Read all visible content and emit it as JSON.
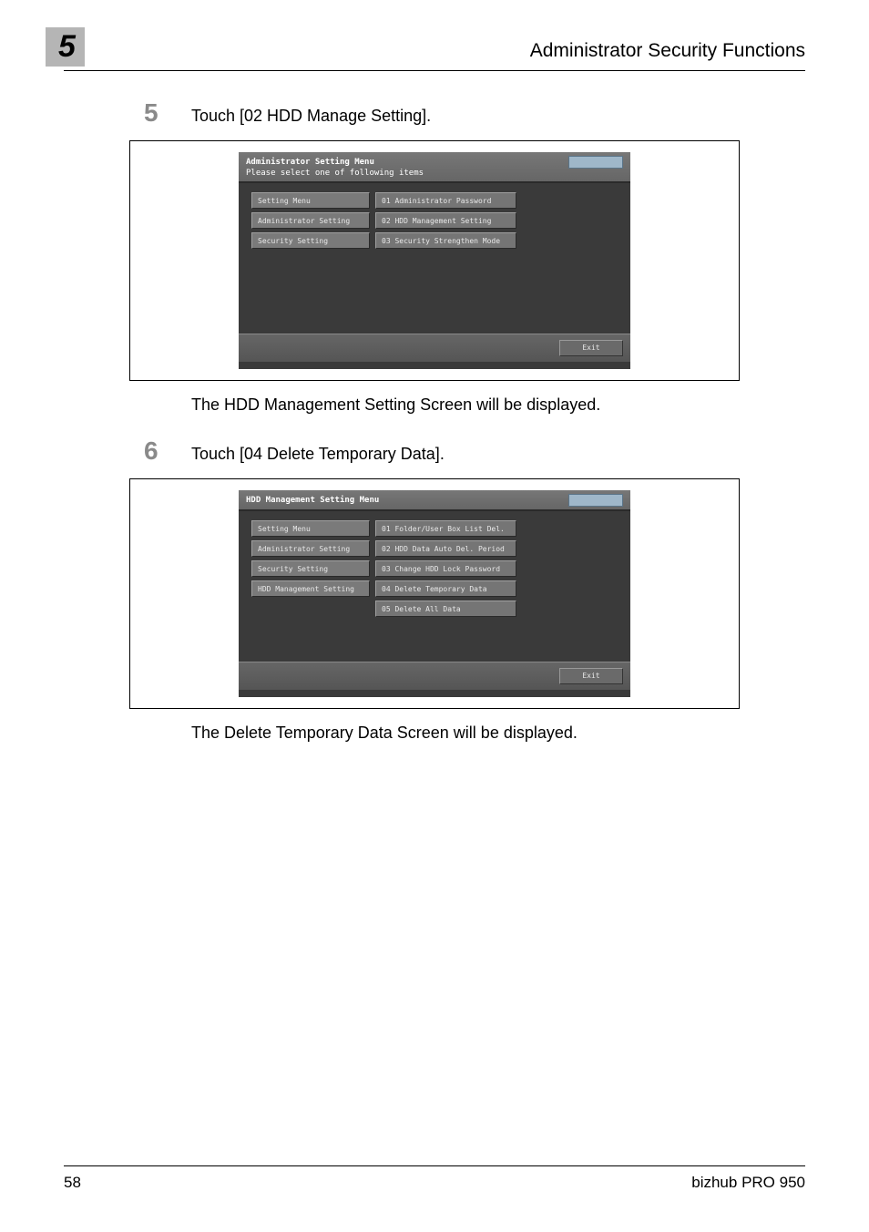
{
  "page": {
    "chapter_num": "5",
    "header_title": "Administrator Security Functions",
    "footer_page": "58",
    "footer_model": "bizhub PRO 950"
  },
  "step5": {
    "num": "5",
    "text": "Touch [02 HDD Manage Setting].",
    "after_text": "The HDD Management Setting Screen will be displayed."
  },
  "step6": {
    "num": "6",
    "text": "Touch [04 Delete Temporary Data].",
    "after_text": "The Delete Temporary Data Screen will be displayed."
  },
  "screen1": {
    "title": "Administrator Setting Menu",
    "subtitle": "Please select one of following items",
    "status": "",
    "left": [
      "Setting Menu",
      "Administrator Setting",
      "Security Setting"
    ],
    "right": [
      "01 Administrator Password",
      "02 HDD Management Setting",
      "03 Security Strengthen Mode"
    ],
    "exit": "Exit"
  },
  "screen2": {
    "title": "HDD Management Setting Menu",
    "subtitle": "",
    "status": "",
    "left": [
      "Setting Menu",
      "Administrator Setting",
      "Security Setting",
      "HDD Management Setting"
    ],
    "right": [
      "01 Folder/User Box List Del.",
      "02 HDD Data Auto Del. Period",
      "03 Change HDD Lock Password",
      "04 Delete Temporary Data",
      "05 Delete All Data"
    ],
    "exit": "Exit"
  }
}
